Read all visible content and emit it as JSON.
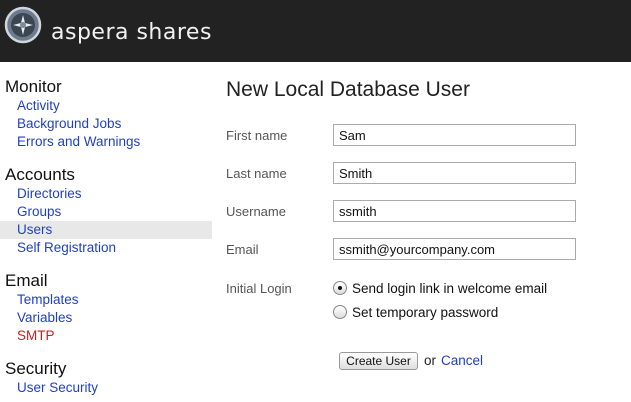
{
  "header": {
    "brand": "aspera shares",
    "logo_icon": "aspera-logo-icon"
  },
  "sidebar": {
    "sections": [
      {
        "title": "Monitor",
        "items": [
          {
            "label": "Activity"
          },
          {
            "label": "Background Jobs"
          },
          {
            "label": "Errors and Warnings"
          }
        ]
      },
      {
        "title": "Accounts",
        "items": [
          {
            "label": "Directories"
          },
          {
            "label": "Groups"
          },
          {
            "label": "Users",
            "selected": true
          },
          {
            "label": "Self Registration"
          }
        ]
      },
      {
        "title": "Email",
        "items": [
          {
            "label": "Templates"
          },
          {
            "label": "Variables"
          },
          {
            "label": "SMTP",
            "status": "warning"
          }
        ]
      },
      {
        "title": "Security",
        "items": [
          {
            "label": "User Security"
          }
        ]
      }
    ],
    "colors": {
      "link": "#1f3fc7",
      "warning": "#d11d1d",
      "selected_bg": "#e8e8e8"
    }
  },
  "main": {
    "title": "New Local Database User",
    "fields": {
      "first_name": {
        "label": "First name",
        "value": "Sam"
      },
      "last_name": {
        "label": "Last name",
        "value": "Smith"
      },
      "username": {
        "label": "Username",
        "value": "ssmith"
      },
      "email": {
        "label": "Email",
        "value": "ssmith@yourcompany.com"
      }
    },
    "initial_login": {
      "label": "Initial Login",
      "options": [
        {
          "label": "Send login link in welcome email",
          "checked": true
        },
        {
          "label": "Set temporary password",
          "checked": false
        }
      ]
    },
    "actions": {
      "create": "Create User",
      "or": "or",
      "cancel": "Cancel"
    }
  }
}
